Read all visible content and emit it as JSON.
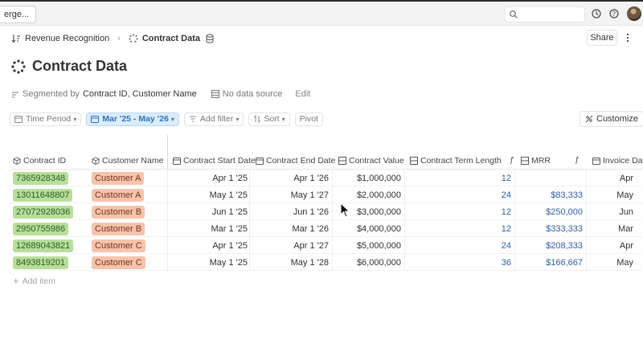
{
  "topbar": {
    "merge_label": "erge..."
  },
  "breadcrumb": {
    "parent": "Revenue Recognition",
    "current": "Contract Data"
  },
  "header": {
    "share_label": "Share",
    "title": "Contract Data"
  },
  "segment": {
    "label": "Segmented by",
    "value": "Contract ID, Customer Name",
    "source": "No data source",
    "edit": "Edit"
  },
  "filters": {
    "time_period": "Time Period",
    "date_range": "Mar '25 - May '26",
    "add_filter": "Add filter",
    "sort": "Sort",
    "pivot": "Pivot",
    "customize": "Customize"
  },
  "columns": [
    "Contract ID",
    "Customer Name",
    "Contract Start Date",
    "Contract End Date",
    "Contract Value",
    "Contract Term Length",
    "MRR",
    "Invoice Da"
  ],
  "rows": [
    {
      "id": "7365928348",
      "customer": "Customer A",
      "start": "Apr 1 '25",
      "end": "Apr 1 '26",
      "value": "$1,000,000",
      "term": "12",
      "mrr": "",
      "invoice": "Apr"
    },
    {
      "id": "13011648807",
      "customer": "Customer A",
      "start": "May 1 '25",
      "end": "May 1 '27",
      "value": "$2,000,000",
      "term": "24",
      "mrr": "$83,333",
      "invoice": "May"
    },
    {
      "id": "27072928036",
      "customer": "Customer B",
      "start": "Jun 1 '25",
      "end": "Jun 1 '26",
      "value": "$3,000,000",
      "term": "12",
      "mrr": "$250,000",
      "invoice": "Jun"
    },
    {
      "id": "2950755986",
      "customer": "Customer B",
      "start": "Mar 1 '25",
      "end": "Mar 1 '26",
      "value": "$4,000,000",
      "term": "12",
      "mrr": "$333,333",
      "invoice": "Mar"
    },
    {
      "id": "12689043821",
      "customer": "Customer C",
      "start": "Apr 1 '25",
      "end": "Apr 1 '27",
      "value": "$5,000,000",
      "term": "24",
      "mrr": "$208,333",
      "invoice": "Apr"
    },
    {
      "id": "8493819201",
      "customer": "Customer C",
      "start": "May 1 '25",
      "end": "May 1 '28",
      "value": "$6,000,000",
      "term": "36",
      "mrr": "$166,667",
      "invoice": "May"
    }
  ],
  "add_item": "Add item",
  "colors": {
    "accent_blue": "#2e73c0",
    "pill_green": "#b7df9b",
    "pill_orange": "#f6c3ad",
    "number_blue": "#2d5da8"
  }
}
